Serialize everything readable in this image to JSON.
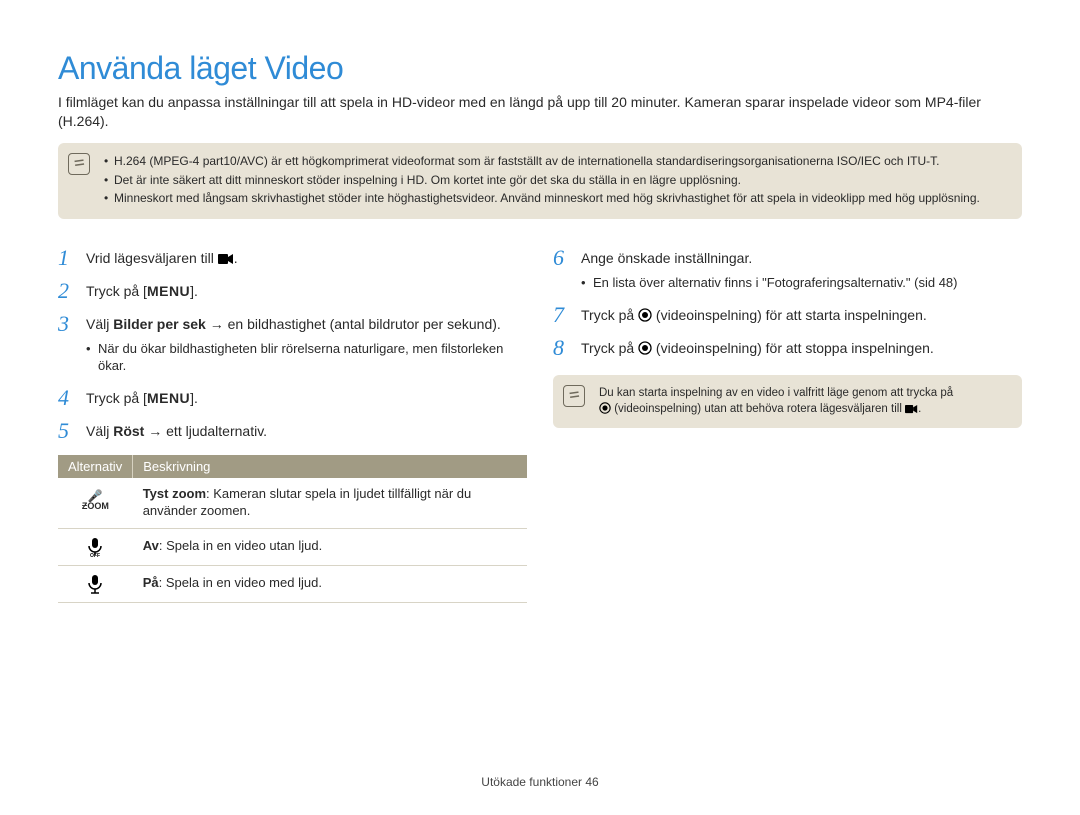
{
  "title": "Använda läget Video",
  "intro": "I filmläget kan du anpassa inställningar till att spela in HD-videor med en längd på upp till 20 minuter. Kameran sparar inspelade videor som MP4-filer (H.264).",
  "top_note": {
    "items": [
      "H.264 (MPEG-4 part10/AVC) är ett högkomprimerat videoformat som är fastställt av de internationella standardiseringsorganisationerna ISO/IEC och ITU-T.",
      "Det är inte säkert att ditt minneskort stöder inspelning i HD. Om kortet inte gör det ska du ställa in en lägre upplösning.",
      "Minneskort med långsam skrivhastighet stöder inte höghastighetsvideor. Använd minneskort med hög skrivhastighet för att spela in videoklipp med hög upplösning."
    ]
  },
  "steps_left": {
    "s1_a": "Vrid lägesväljaren till ",
    "s1_b": ".",
    "s2_a": "Tryck på [",
    "s2_menu": "MENU",
    "s2_b": "].",
    "s3_a": "Välj ",
    "s3_bold": "Bilder per sek",
    "s3_b": " → en bildhastighet (antal bildrutor per sekund).",
    "s3_sub": "När du ökar bildhastigheten blir rörelserna naturligare, men filstorleken ökar.",
    "s4_a": "Tryck på [",
    "s4_menu": "MENU",
    "s4_b": "].",
    "s5_a": "Välj ",
    "s5_bold": "Röst",
    "s5_b": " → ett ljudalternativ."
  },
  "table": {
    "h1": "Alternativ",
    "h2": "Beskrivning",
    "rows": [
      {
        "icon": "zoom",
        "bold": "Tyst zoom",
        "text": ": Kameran slutar spela in ljudet tillfälligt när du använder zoomen."
      },
      {
        "icon": "mic-off",
        "bold": "Av",
        "text": ": Spela in en video utan ljud."
      },
      {
        "icon": "mic-on",
        "bold": "På",
        "text": ": Spela in en video med ljud."
      }
    ]
  },
  "steps_right": {
    "s6": "Ange önskade inställningar.",
    "s6_sub": "En lista över alternativ finns i \"Fotograferingsalternativ.\" (sid 48)",
    "s7_a": "Tryck på ",
    "s7_b": " (videoinspelning) för att starta inspelningen.",
    "s8_a": "Tryck på ",
    "s8_b": " (videoinspelning) för att stoppa inspelningen."
  },
  "right_note": {
    "l1_a": "Du kan starta inspelning av en video i valfritt läge genom att trycka på",
    "l2_a": " (videoinspelning) utan att behöva rotera lägesväljaren till ",
    "l2_b": "."
  },
  "footer_a": "Utökade funktioner  ",
  "footer_b": "46"
}
